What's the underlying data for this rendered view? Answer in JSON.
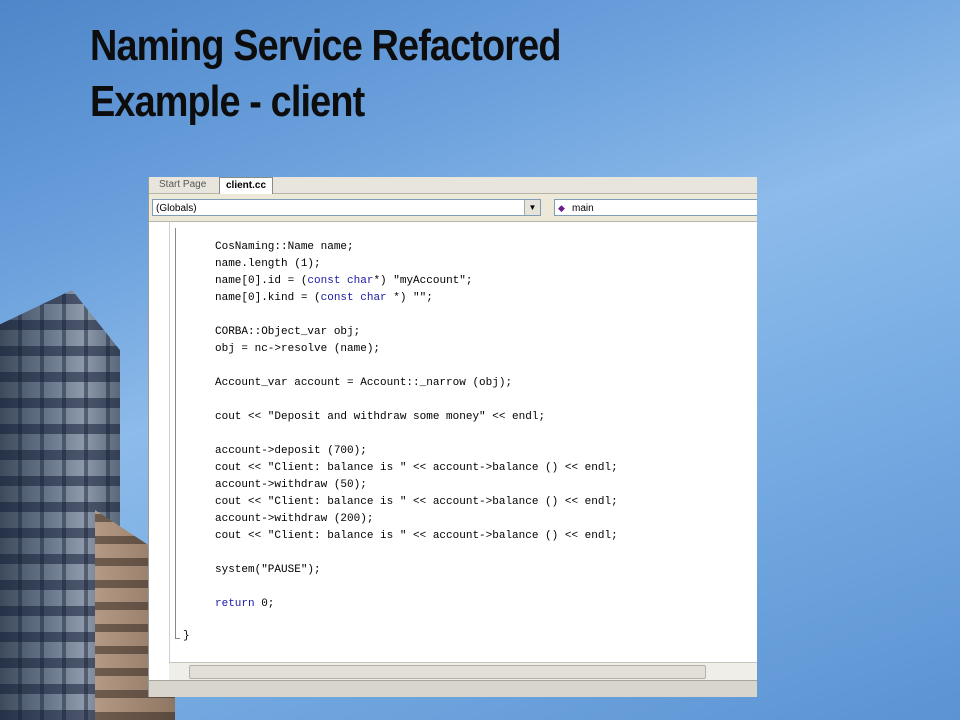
{
  "slide": {
    "title_line1": "Naming Service Refactored",
    "title_line2": "Example - client"
  },
  "ide": {
    "tabs": [
      {
        "label": "Start Page",
        "active": false
      },
      {
        "label": "client.cc",
        "active": true
      }
    ],
    "scope_combo": {
      "value": "(Globals)",
      "icon": "chevron-down-icon"
    },
    "member_combo": {
      "value": "main",
      "icon": "function-member-icon"
    },
    "code_lines": [
      "CosNaming::Name name;",
      "name.length (1);",
      "name[0].id = (const char*) \"myAccount\";",
      "name[0].kind = (const char *) \"\";",
      "",
      "CORBA::Object_var obj;",
      "obj = nc->resolve (name);",
      "",
      "Account_var account = Account::_narrow (obj);",
      "",
      "cout << \"Deposit and withdraw some money\" << endl;",
      "",
      "account->deposit (700);",
      "cout << \"Client: balance is \" << account->balance () << endl;",
      "account->withdraw (50);",
      "cout << \"Client: balance is \" << account->balance () << endl;",
      "account->withdraw (200);",
      "cout << \"Client: balance is \" << account->balance () << endl;",
      "",
      "system(\"PAUSE\");",
      "",
      "return 0;"
    ],
    "closing_brace": "}",
    "keyword_color": "#1a1aa6"
  }
}
